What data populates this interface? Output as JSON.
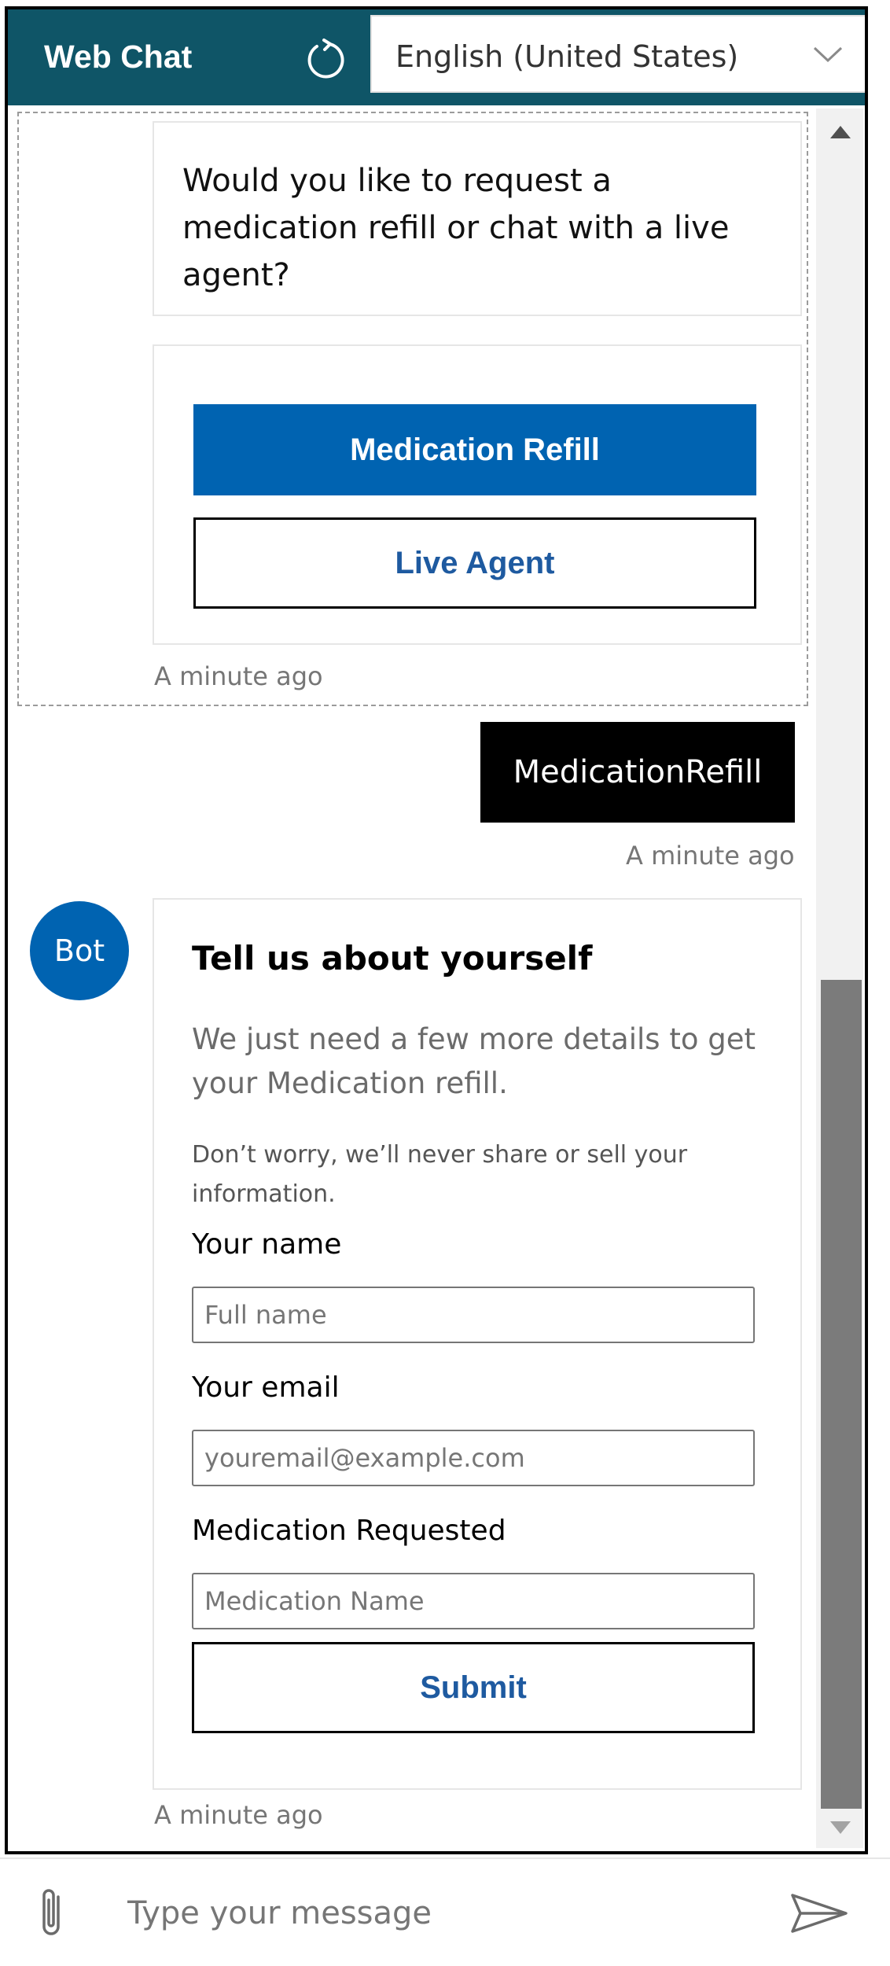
{
  "header": {
    "title": "Web Chat",
    "refresh_icon": "refresh-icon",
    "language_selected": "English (United States)",
    "dropdown_icon": "chevron-down-icon",
    "background_color": "#0f5567"
  },
  "transcript": {
    "prompt": {
      "text": "Would you like to request a medication refill or chat with a live agent?",
      "actions": [
        {
          "label": "Medication Refill"
        },
        {
          "label": "Live Agent"
        }
      ],
      "timestamp": "A minute ago"
    },
    "user_message": {
      "text": "MedicationRefill",
      "timestamp": "A minute ago"
    },
    "bot_form": {
      "avatar_initials": "Bot",
      "title": "Tell us about yourself",
      "subtitle": "We just need a few more details to get your Medication refill.",
      "note": "Don’t worry, we’ll never share or sell your information.",
      "fields": [
        {
          "label": "Your name",
          "placeholder": "Full name",
          "value": ""
        },
        {
          "label": "Your email",
          "placeholder": "youremail@example.com",
          "value": ""
        },
        {
          "label": "Medication Requested",
          "placeholder": "Medication Name",
          "value": ""
        }
      ],
      "submit_label": "Submit",
      "timestamp": "A minute ago"
    }
  },
  "sendbox": {
    "placeholder": "Type your message",
    "value": "",
    "attach_icon": "paperclip-icon",
    "send_icon": "send-icon"
  },
  "colors": {
    "accent": "#0063b1",
    "link_text": "#1e5aa0",
    "user_bubble": "#000000"
  }
}
